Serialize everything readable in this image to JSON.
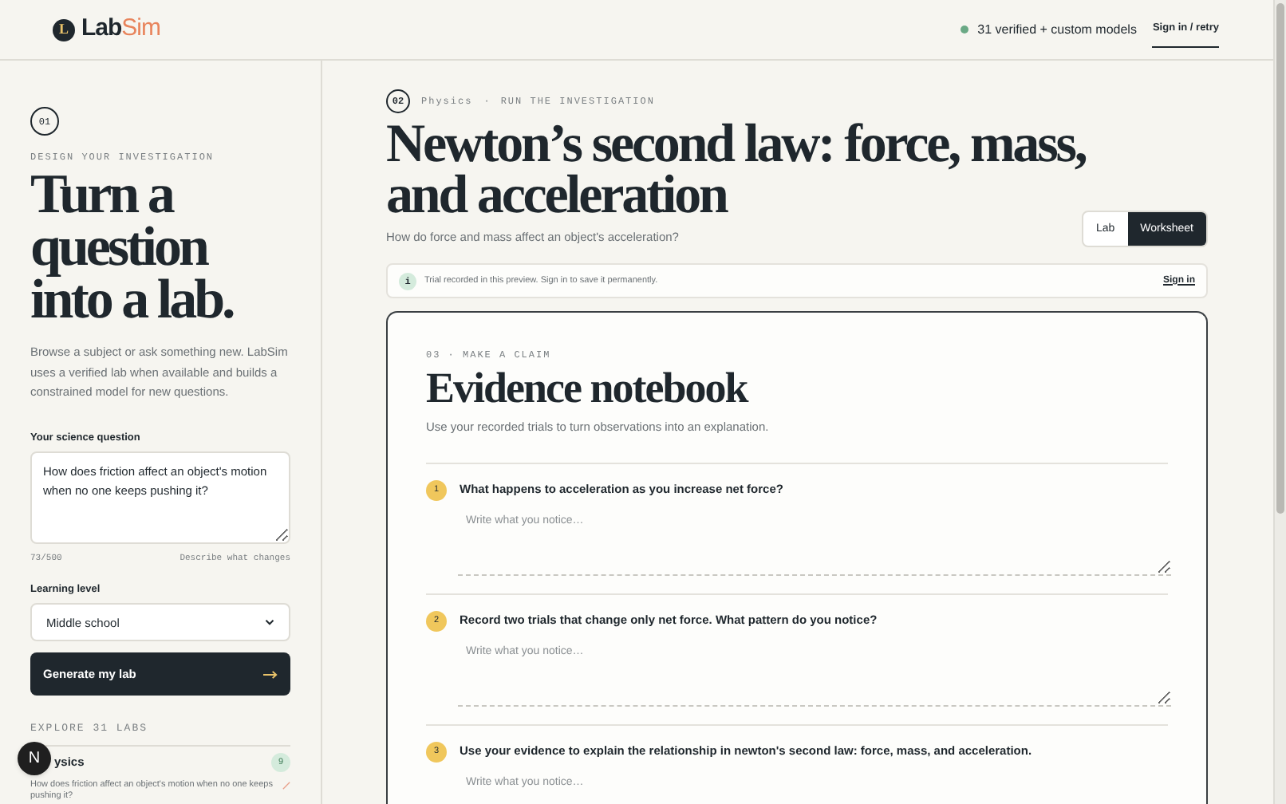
{
  "header": {
    "logo_mark": "L",
    "logo_primary": "Lab",
    "logo_accent": "Sim",
    "status": "31 verified + custom models",
    "status_online": true,
    "sign_in": "Sign in / retry"
  },
  "sidebar": {
    "step": "01",
    "eyebrow": "DESIGN YOUR INVESTIGATION",
    "title": "Turn a question into a lab.",
    "intro": "Browse a subject or ask something new. LabSim uses a verified lab when available and builds a constrained model for new questions.",
    "question_label": "Your science question",
    "question_value": "How does friction affect an object's motion when no one keeps pushing it?",
    "counter": "73/500",
    "hint": "Describe what changes",
    "level_label": "Learning level",
    "level_value": "Middle school",
    "generate": "Generate my lab",
    "explore": "EXPLORE 31 LABS",
    "subjects": [
      {
        "name": "ysics",
        "count": "9",
        "labs": [
          "How does friction affect an object's motion when no one keeps pushing it?"
        ]
      }
    ]
  },
  "main": {
    "step": "02",
    "subject": "Physics",
    "separator": "·",
    "stage": "RUN THE INVESTIGATION",
    "title": "Newton’s second law: force, mass, and acceleration",
    "question": "How do force and mass affect an object's acceleration?",
    "tabs": [
      {
        "label": "Lab",
        "selected": false
      },
      {
        "label": "Worksheet",
        "selected": true
      }
    ],
    "notice": {
      "icon": "i",
      "text": "Trial recorded in this preview. Sign in to save it permanently.",
      "link": "Sign in"
    },
    "notebook": {
      "eyebrow": "03 · MAKE A CLAIM",
      "title": "Evidence notebook",
      "intro": "Use your recorded trials to turn observations into an explanation.",
      "prompts": [
        {
          "number": "1",
          "text": "What happens to acceleration as you increase net force?",
          "placeholder": "Write what you notice…"
        },
        {
          "number": "2",
          "text": "Record two trials that change only net force. What pattern do you notice?",
          "placeholder": "Write what you notice…"
        },
        {
          "number": "3",
          "text": "Use your evidence to explain the relationship in newton's second law: force, mass, and acceleration.",
          "placeholder": "Write what you notice…"
        }
      ]
    }
  },
  "dev_badge": "N"
}
